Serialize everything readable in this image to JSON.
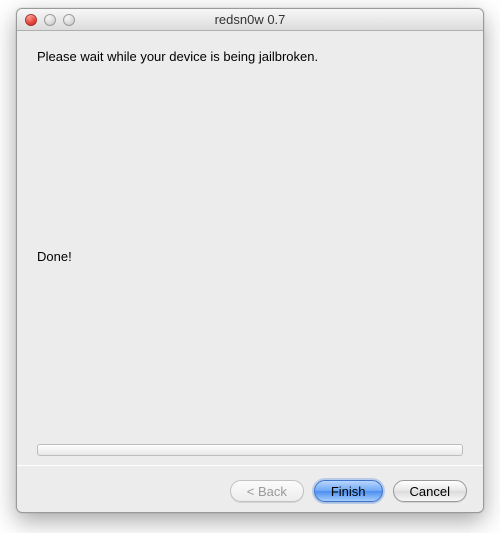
{
  "window": {
    "title": "redsn0w 0.7"
  },
  "content": {
    "instruction": "Please wait while your device is being jailbroken.",
    "status": "Done!"
  },
  "buttons": {
    "back": "< Back",
    "finish": "Finish",
    "cancel": "Cancel"
  }
}
